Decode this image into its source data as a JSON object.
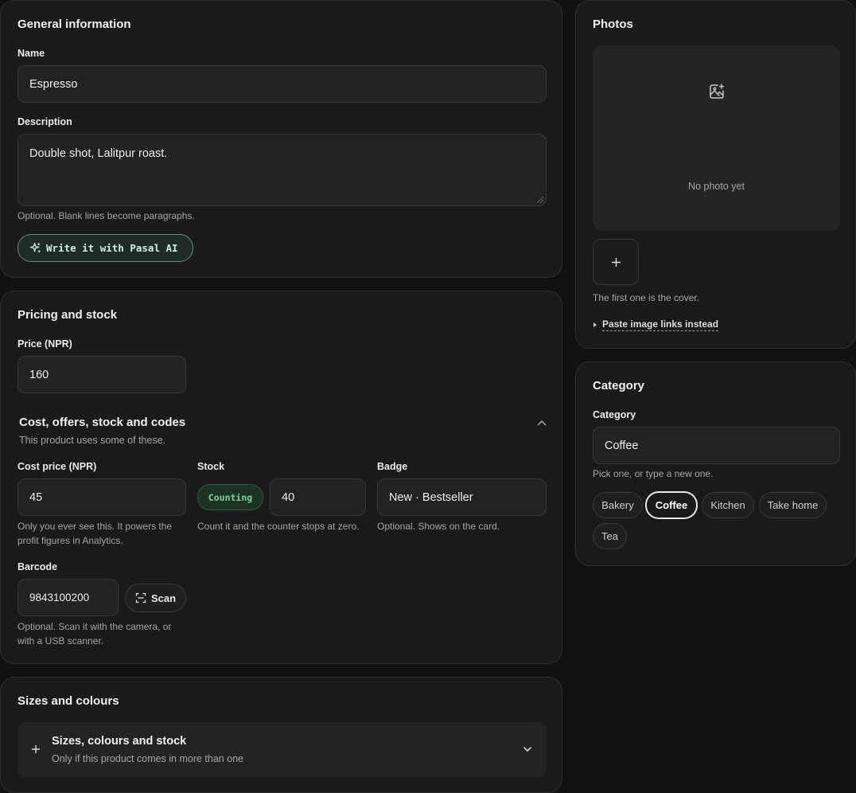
{
  "general": {
    "title": "General information",
    "name_label": "Name",
    "name_value": "Espresso",
    "description_label": "Description",
    "description_value": "Double shot, Lalitpur roast.",
    "description_hint": "Optional. Blank lines become paragraphs.",
    "ai_button_label": "Write it with Pasal AI"
  },
  "pricing": {
    "title": "Pricing and stock",
    "price_label": "Price (NPR)",
    "price_value": "160",
    "section_title": "Cost, offers, stock and codes",
    "section_subtitle": "This product uses some of these.",
    "cost_label": "Cost price (NPR)",
    "cost_value": "45",
    "cost_hint": "Only you ever see this. It powers the profit figures in Analytics.",
    "stock_label": "Stock",
    "stock_mode": "Counting",
    "stock_value": "40",
    "stock_hint": "Count it and the counter stops at zero.",
    "badge_label": "Badge",
    "badge_value": "New · Bestseller",
    "badge_hint": "Optional. Shows on the card.",
    "barcode_label": "Barcode",
    "barcode_value": "9843100200",
    "scan_label": "Scan",
    "barcode_hint": "Optional. Scan it with the camera, or with a USB scanner."
  },
  "variants": {
    "title": "Sizes and colours",
    "row_title": "Sizes, colours and stock",
    "row_subtitle": "Only if this product comes in more than one"
  },
  "photos": {
    "title": "Photos",
    "empty_text": "No photo yet",
    "cover_hint": "The first one is the cover.",
    "paste_link": "Paste image links instead"
  },
  "category": {
    "title": "Category",
    "label": "Category",
    "value": "Coffee",
    "hint": "Pick one, or type a new one.",
    "options": [
      "Bakery",
      "Coffee",
      "Kitchen",
      "Take home",
      "Tea"
    ],
    "selected": "Coffee"
  },
  "colors": {
    "background": "#111111",
    "card": "#1a1a1a",
    "accent_green": "#7fd09a",
    "ai_border": "#5f8f80"
  },
  "icons": {
    "ai": "sparkles-icon",
    "scan": "scan-icon",
    "collapse": "chevron-up-icon",
    "expand": "chevron-down-icon",
    "photo": "image-plus-icon",
    "add": "plus-icon",
    "disclosure": "triangle-right-icon"
  }
}
